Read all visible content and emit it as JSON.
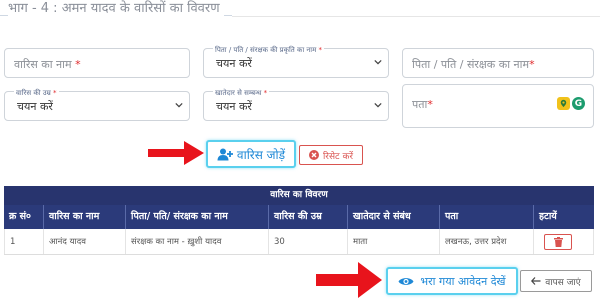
{
  "section": {
    "title": "भाग - 4 : अमन यादव के वारिसों का विवरण"
  },
  "form": {
    "heir_name": {
      "placeholder": "वारिस का नाम",
      "required_mark": "*"
    },
    "guardian_type": {
      "label": "पिता / पति / संरक्षक की प्रकृति का नाम",
      "required_mark": "*",
      "value": "चयन करें"
    },
    "father_name": {
      "placeholder": "पिता / पति / संरक्षक का नाम",
      "required_mark": "*"
    },
    "heir_age": {
      "label": "वारिस की उम्र",
      "required_mark": "*",
      "value": "चयन करें"
    },
    "relation": {
      "label": "खातेदार से सम्बन्ध",
      "required_mark": "*",
      "value": "चयन करें"
    },
    "address": {
      "placeholder": "पता",
      "required_mark": "*",
      "icons": [
        "location-pin-icon",
        "grammarly-icon"
      ]
    }
  },
  "buttons": {
    "add_heir": "वारिस जोड़ें",
    "reset": "रिसेट करें",
    "view_application": "भरा गया आवेदन देखें",
    "go_back": "वापस जाएं"
  },
  "table": {
    "title": "वारिस का विवरण",
    "columns": [
      "क्र सं०",
      "वारिस का नाम",
      "पिता/ पति/ संरक्षक का नाम",
      "वारिस की उम्र",
      "खातेदार से संबंध",
      "पता",
      "हटायें"
    ],
    "rows": [
      {
        "sno": "1",
        "name": "आनंद यादव",
        "guardian": "संरक्षक का नाम - ख़ुशी यादव",
        "age": "30",
        "relation": "माता",
        "address": "लखनऊ, उत्तर प्रदेश"
      }
    ]
  },
  "colors": {
    "header": "#2b3a7a",
    "accent": "#1e88d6",
    "danger": "#d9534f",
    "arrow": "#e8141c"
  }
}
